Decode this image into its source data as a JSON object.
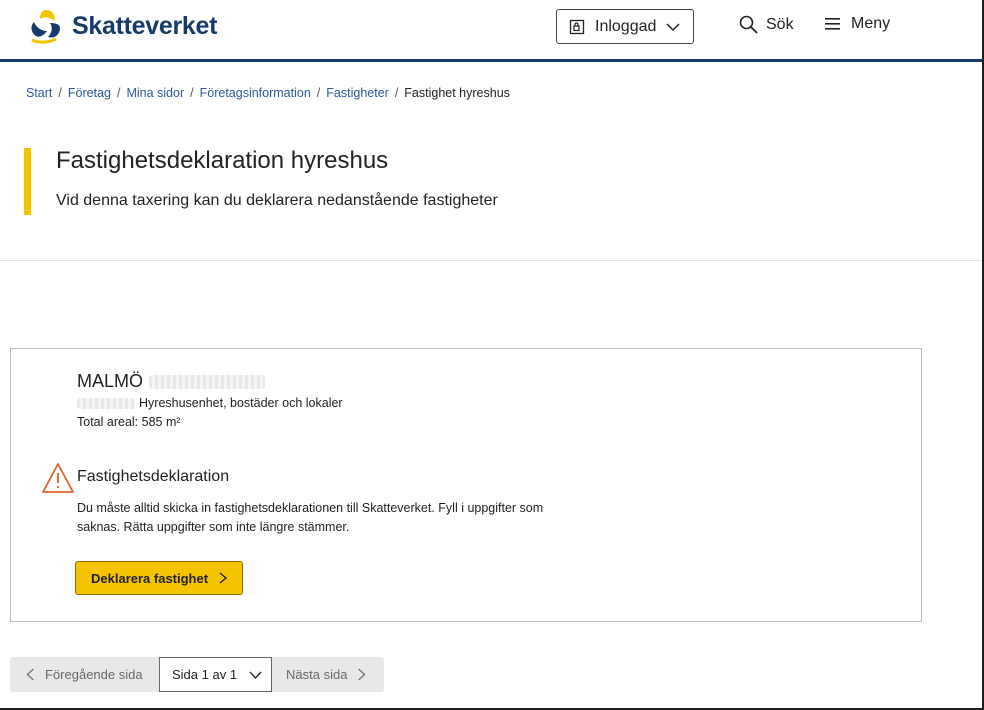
{
  "header": {
    "brand": "Skatteverket",
    "login_label": "Inloggad",
    "search_label": "Sök",
    "menu_label": "Meny"
  },
  "breadcrumb": {
    "items": [
      "Start",
      "Företag",
      "Mina sidor",
      "Företagsinformation",
      "Fastigheter"
    ],
    "current": "Fastighet hyreshus",
    "separator": "/"
  },
  "page": {
    "title": "Fastighetsdeklaration hyreshus",
    "subtitle": "Vid denna taxering kan du deklarera nedanstående fastigheter"
  },
  "property": {
    "name": "MALMÖ",
    "type": "Hyreshusenhet, bostäder och lokaler",
    "area": "Total areal: 585 m²",
    "warning_title": "Fastighetsdeklaration",
    "warning_text": "Du måste alltid skicka in fastighetsdeklarationen till Skatteverket. Fyll i uppgifter som saknas. Rätta uppgifter som inte längre stämmer.",
    "declare_label": "Deklarera fastighet"
  },
  "pagination": {
    "prev_label": "Föregående sida",
    "page_label": "Sida 1 av 1",
    "next_label": "Nästa sida"
  },
  "colors": {
    "brand_blue": "#163a6b",
    "accent_yellow": "#f5c400",
    "warning_orange": "#e2622a",
    "link_blue": "#2b5a9a"
  }
}
